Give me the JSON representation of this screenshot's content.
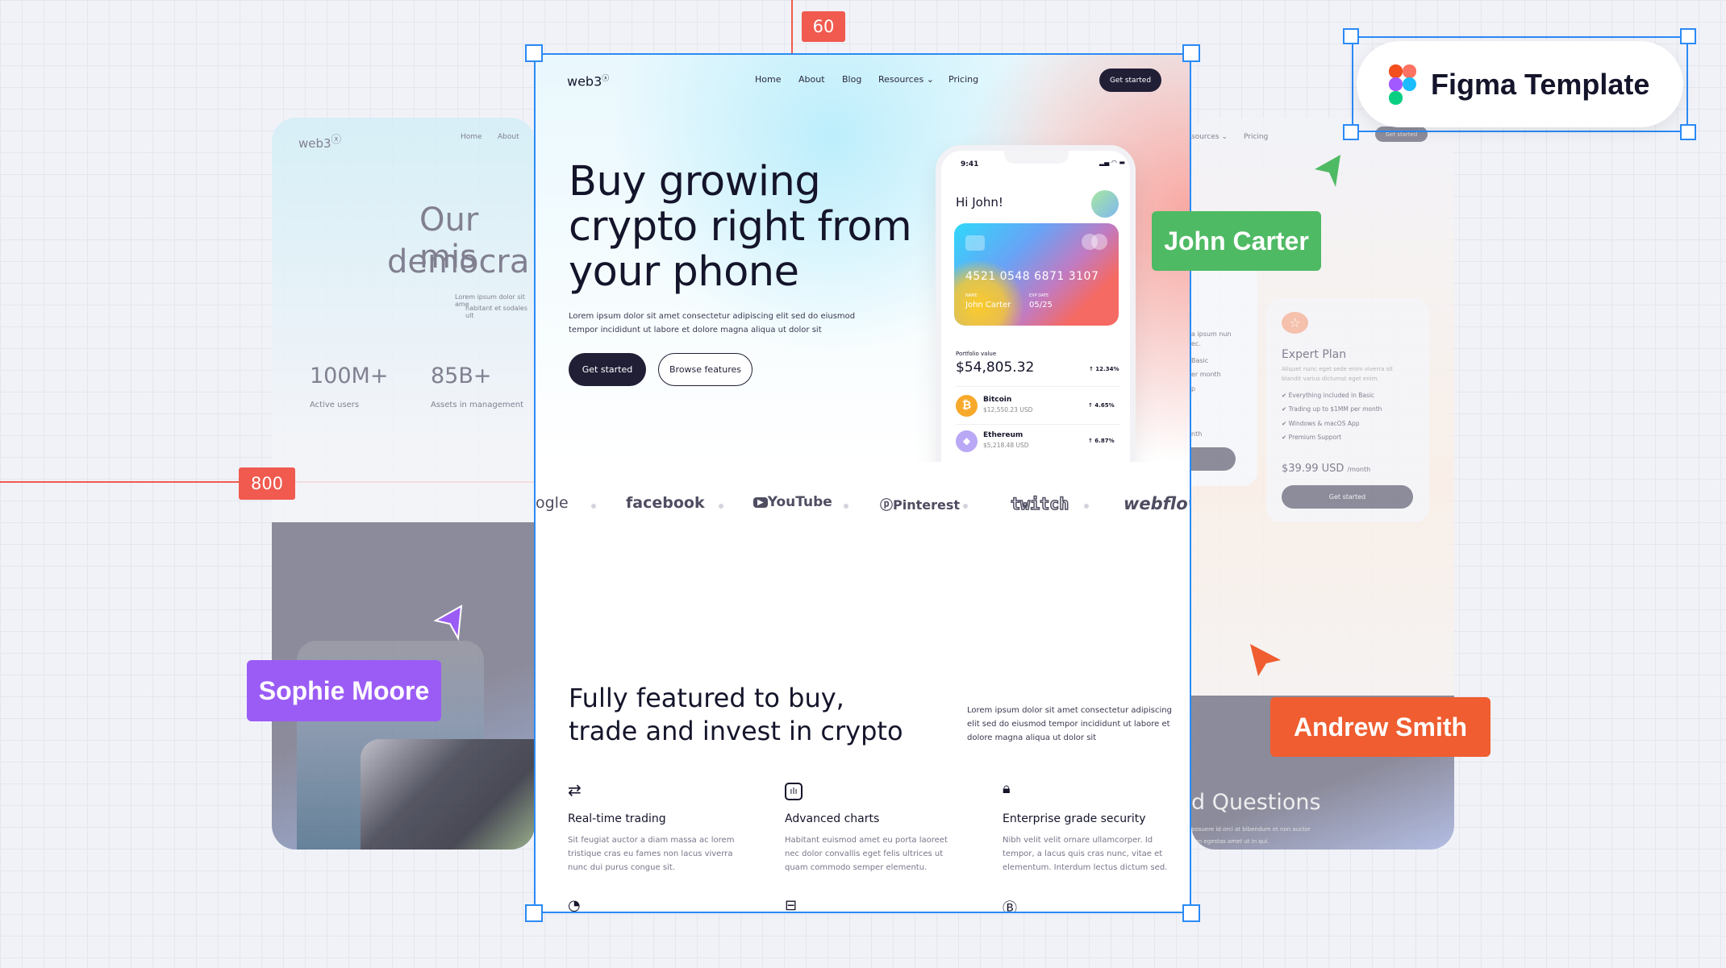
{
  "guides": {
    "top_value": "60",
    "left_value": "800",
    "color": "#f05a4f"
  },
  "figma_badge": {
    "label": "Figma Template",
    "icon": "figma-logo-icon"
  },
  "cursors": [
    {
      "name": "John Carter",
      "color": "#4fba64"
    },
    {
      "name": "Sophie Moore",
      "color": "#9b5cf6"
    },
    {
      "name": "Andrew Smith",
      "color": "#ef5d30"
    }
  ],
  "left_page": {
    "logo": "web3",
    "nav": [
      "Home",
      "About"
    ],
    "heading": [
      "Our mis",
      "democra"
    ],
    "text": [
      "Lorem ipsum dolor sit ame",
      "habitant et sodales ult"
    ],
    "stats": [
      {
        "value": "100M+",
        "label": "Active users"
      },
      {
        "value": "85B+",
        "label": "Assets in management"
      }
    ]
  },
  "right_page": {
    "nav": [
      "sources",
      "Pricing"
    ],
    "cta": "Get started",
    "partial_card": [
      "a ipsum nun",
      "ec.",
      "Basic",
      "er month",
      "p",
      "nth"
    ],
    "expert": {
      "title": "Expert Plan",
      "desc": [
        "Aliquet nunc eget sede enim viverra sit",
        "blandit varius dictumst eget enim."
      ],
      "features": [
        "Everything included in Basic",
        "Trading up to $1MM per month",
        "Windows & macOS App",
        "Premium Support"
      ],
      "price": "$39.99 USD",
      "period": "/month",
      "cta": "Get started"
    },
    "faq_title": "d Questions",
    "faq_text": [
      "posuere id orci at bibendum et non auctor",
      "non egestas amet ut in qui."
    ]
  },
  "main": {
    "logo": "web3",
    "nav": [
      "Home",
      "About",
      "Blog",
      "Resources",
      "Pricing"
    ],
    "nav_cta": "Get started",
    "hero_title": [
      "Buy growing",
      "crypto right from",
      "your phone"
    ],
    "hero_text": [
      "Lorem ipsum dolor sit amet consectetur adipiscing elit sed do eiusmod",
      "tempor incididunt ut labore et dolore magna aliqua ut dolor sit"
    ],
    "primary_cta": "Get started",
    "secondary_cta": "Browse features",
    "phone": {
      "time": "9:41",
      "greeting": "Hi John!",
      "card_number": "4521 0548 6871 3107",
      "name_label": "NAME",
      "name": "John Carter",
      "exp_label": "EXP DATE",
      "exp": "05/25",
      "portfolio_label": "Portfolio value",
      "portfolio_value": "$54,805.32",
      "portfolio_change": "↑ 12.34%",
      "assets": [
        {
          "name": "Bitcoin",
          "value": "$12,550.23 USD",
          "change": "↑ 4.65%",
          "color": "#f7a92b",
          "symbol": "₿"
        },
        {
          "name": "Ethereum",
          "value": "$5,218.48 USD",
          "change": "↑ 6.87%",
          "color": "#b9a8f5",
          "symbol": "◆"
        }
      ]
    },
    "logos": [
      "ogle",
      "facebook",
      "YouTube",
      "Pinterest",
      "twitch",
      "webflow"
    ],
    "section_title": [
      "Fully featured to buy,",
      "trade and invest in crypto"
    ],
    "section_text": [
      "Lorem ipsum dolor sit amet consectetur adipiscing",
      "elit sed do eiusmod tempor incididunt ut labore et",
      "dolore magna aliqua ut dolor sit"
    ],
    "features": [
      {
        "icon": "arrows-exchange-icon",
        "title": "Real-time trading",
        "desc": "Sit feugiat auctor a diam massa ac lorem tristique cras eu fames non lacus viverra nunc dui purus congue sit."
      },
      {
        "icon": "bar-chart-icon",
        "title": "Advanced charts",
        "desc": "Habitant euismod amet eu porta laoreet nec dolor convallis eget felis ultrices ut quam commodo semper elementu."
      },
      {
        "icon": "lock-icon",
        "title": "Enterprise grade security",
        "desc": "Nibh velit velit ornare ullamcorper. Id tempor, a lacus quis cras nunc, vitae et elementum. Interdum lectus dictum sed."
      }
    ]
  }
}
